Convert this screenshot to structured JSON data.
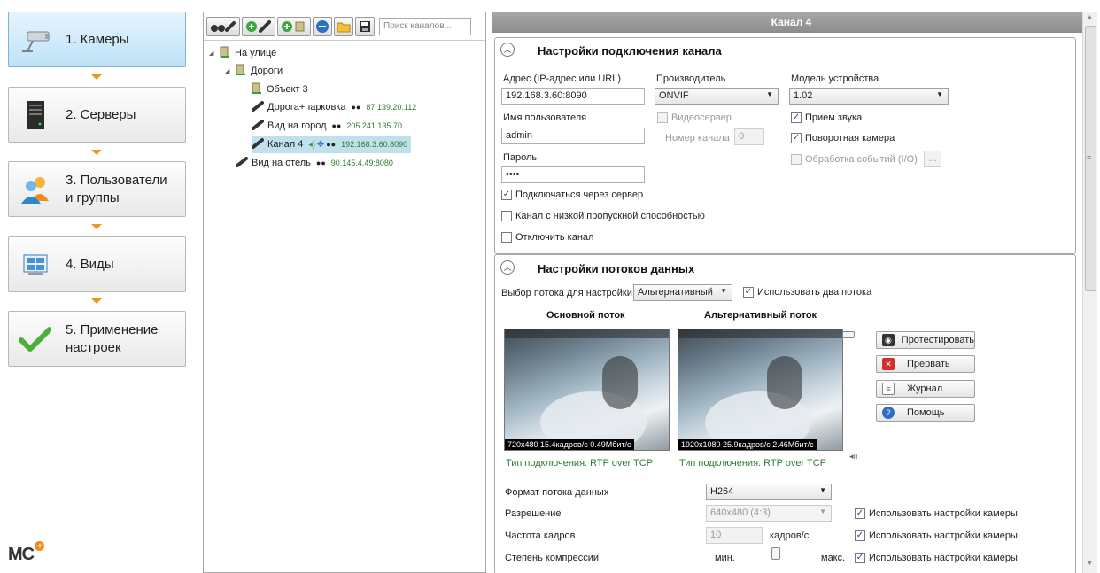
{
  "wizard": {
    "steps": [
      {
        "label": "1. Камеры",
        "icon": "camera-icon",
        "active": true
      },
      {
        "label": "2. Серверы",
        "icon": "server-icon",
        "active": false
      },
      {
        "label": "3. Пользователи и группы",
        "line1": "3. Пользователи",
        "line2": "и группы",
        "icon": "users-icon",
        "active": false
      },
      {
        "label": "4. Виды",
        "icon": "views-icon",
        "active": false
      },
      {
        "label": "5. Применение настроек",
        "line1": "5. Применение",
        "line2": "настроек",
        "icon": "checkmark-icon",
        "active": false
      }
    ],
    "logo": "MC"
  },
  "tree_panel": {
    "search_placeholder": "Поиск каналов...",
    "nodes": [
      {
        "label": "На улице",
        "type": "folder",
        "level": 0
      },
      {
        "label": "Дороги",
        "type": "folder",
        "level": 1
      },
      {
        "label": "Объект 3",
        "type": "folder",
        "level": 2
      },
      {
        "label": "Дорога+парковка",
        "type": "camera",
        "ip": "87.139.20.112",
        "level": 2
      },
      {
        "label": "Вид на город",
        "type": "camera",
        "ip": "205.241.135.70",
        "level": 2
      },
      {
        "label": "Канал 4",
        "type": "camera",
        "ip": "192.168.3.60:8090",
        "level": 2,
        "selected": true
      },
      {
        "label": "Вид на отель",
        "type": "camera",
        "ip": "90.145.4.49:8080",
        "level": 1
      }
    ]
  },
  "channel": {
    "title": "Канал 4",
    "connection": {
      "title": "Настройки подключения канала",
      "address_label": "Адрес (IP-адрес или URL)",
      "address_value": "192.168.3.60:8090",
      "manufacturer_label": "Производитель",
      "manufacturer_value": "ONVIF",
      "model_label": "Модель устройства",
      "model_value": "1.02",
      "username_label": "Имя пользователя",
      "username_value": "admin",
      "videoserver_label": "Видеосервер",
      "channel_no_label": "Номер канала",
      "channel_no_value": "0",
      "audio_label": "Прием звука",
      "ptz_label": "Поворотная камера",
      "password_label": "Пароль",
      "password_value": "••••",
      "events_label": "Обработка событий (I/O)",
      "events_btn": "...",
      "via_server_label": "Подключаться через сервер",
      "low_bandwidth_label": "Канал с низкой пропускной способностью",
      "disable_label": "Отключить канал"
    },
    "streams": {
      "title": "Настройки потоков данных",
      "select_label": "Выбор потока для настройки",
      "select_value": "Альтернативный",
      "use_two_label": "Использовать два потока",
      "main_header": "Основной поток",
      "alt_header": "Альтернативный поток",
      "main_stat": "720x480  15.4кадров/с  0.49Мбит/с",
      "alt_stat": "1920x1080  25.9кадров/с  2.46Мбит/с",
      "main_conn": "Тип подключения:  RTP over TCP",
      "alt_conn": "Тип подключения:  RTP over TCP",
      "buttons": {
        "test": "Протестировать",
        "abort": "Прервать",
        "log": "Журнал",
        "help": "Помощь"
      },
      "format_label": "Формат потока данных",
      "format_value": "H264",
      "resolution_label": "Разрешение",
      "resolution_value": "640x480     (4:3)",
      "fps_label": "Частота кадров",
      "fps_value": "10",
      "fps_unit": "кадров/с",
      "compression_label": "Степень компрессии",
      "comp_min": "мин.",
      "comp_max": "макс.",
      "use_camera_settings": "Использовать настройки камеры"
    }
  },
  "colors": {
    "accent": "#f0961e",
    "ip_green": "#2e7d32",
    "active_step": "#bfe2f8",
    "title_bar": "#9a9a9a"
  }
}
